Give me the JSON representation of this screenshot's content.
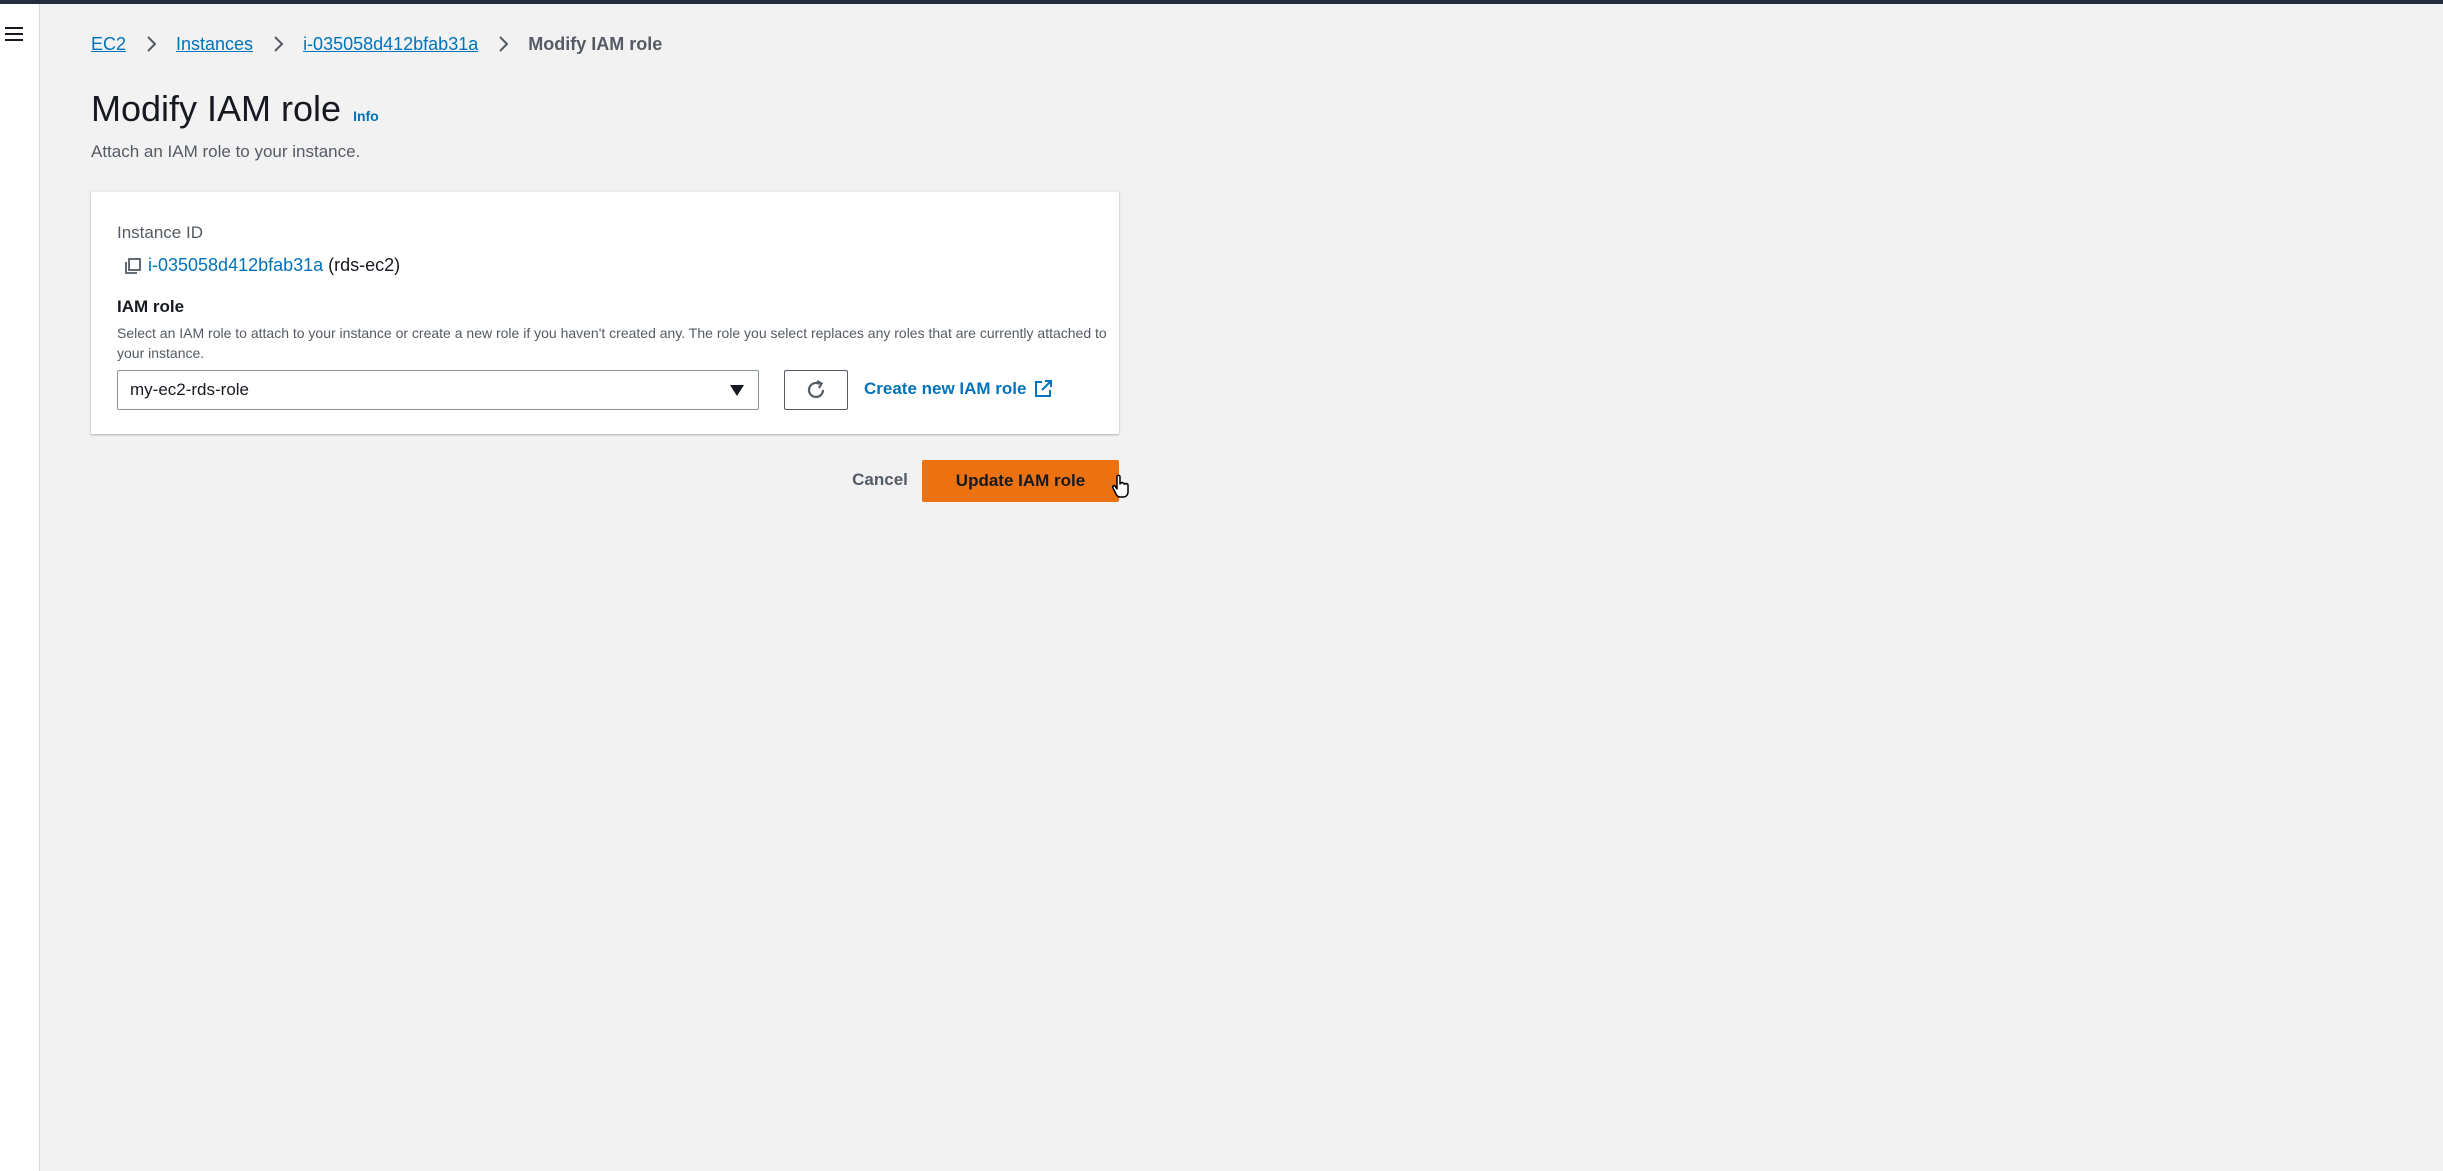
{
  "breadcrumb": {
    "items": [
      "EC2",
      "Instances",
      "i-035058d412bfab31a"
    ],
    "current": "Modify IAM role"
  },
  "header": {
    "title": "Modify IAM role",
    "info": "Info",
    "description": "Attach an IAM role to your instance."
  },
  "panel": {
    "instance_id_label": "Instance ID",
    "instance_id": "i-035058d412bfab31a",
    "instance_name": "(rds-ec2)",
    "iam_role_label": "IAM role",
    "iam_role_description": "Select an IAM role to attach to your instance or create a new role if you haven't created any. The role you select replaces any roles that are currently attached to your instance.",
    "selected_role": "my-ec2-rds-role",
    "create_role_link": "Create new IAM role"
  },
  "actions": {
    "cancel": "Cancel",
    "update": "Update IAM role"
  },
  "icons": {
    "menu": "hamburger-menu-icon",
    "breadcrumb_separator": "chevron-right-icon",
    "copy": "copy-icon",
    "refresh": "refresh-icon",
    "external": "external-link-icon",
    "dropdown": "caret-down-icon",
    "cursor": "hand-pointer-icon"
  },
  "colors": {
    "link": "#0073bb",
    "primary_button": "#ec7211",
    "background": "#f2f2f2",
    "top_strip": "#232f3e"
  }
}
